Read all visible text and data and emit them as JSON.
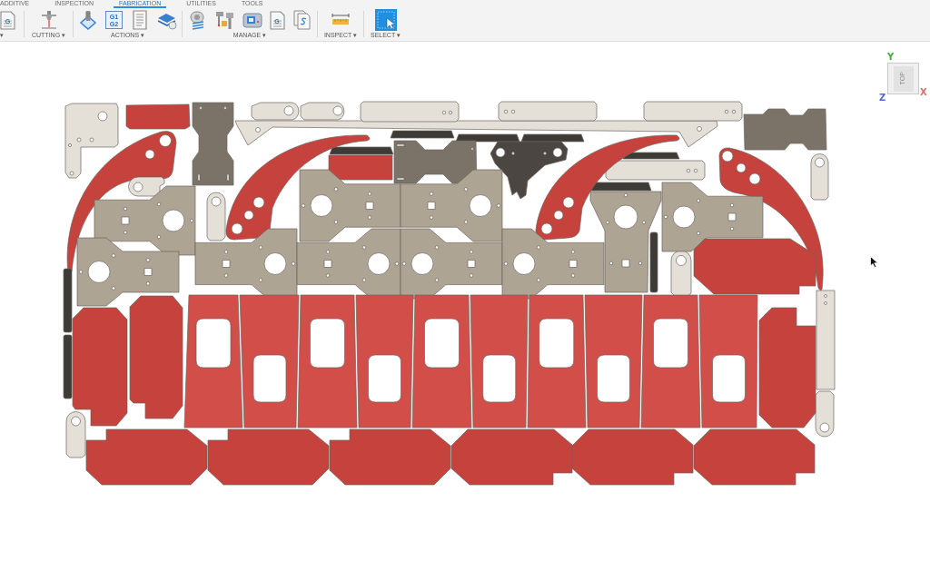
{
  "tabs": [
    {
      "label": "ADDITIVE",
      "selected": false
    },
    {
      "label": "INSPECTION",
      "selected": false
    },
    {
      "label": "FABRICATION",
      "selected": true
    },
    {
      "label": "UTILITIES",
      "selected": false
    },
    {
      "label": "TOOLS",
      "selected": false
    }
  ],
  "toolbar_groups": [
    {
      "label": "▾",
      "icon_texts": [
        "G"
      ]
    },
    {
      "label": "CUTTING ▾"
    },
    {
      "label": "ACTIONS ▾",
      "icon_texts": [
        "G1 G2"
      ]
    },
    {
      "label": "MANAGE ▾",
      "icon_texts": [
        "G"
      ]
    },
    {
      "label": "INSPECT ▾"
    },
    {
      "label": "SELECT ▾"
    }
  ],
  "view_cube": {
    "face": "TOP",
    "axes": [
      {
        "label": "Y",
        "color": "#3fae3f"
      },
      {
        "label": "X",
        "color": "#e26a6a"
      },
      {
        "label": "Z",
        "color": "#5566dd"
      }
    ]
  }
}
